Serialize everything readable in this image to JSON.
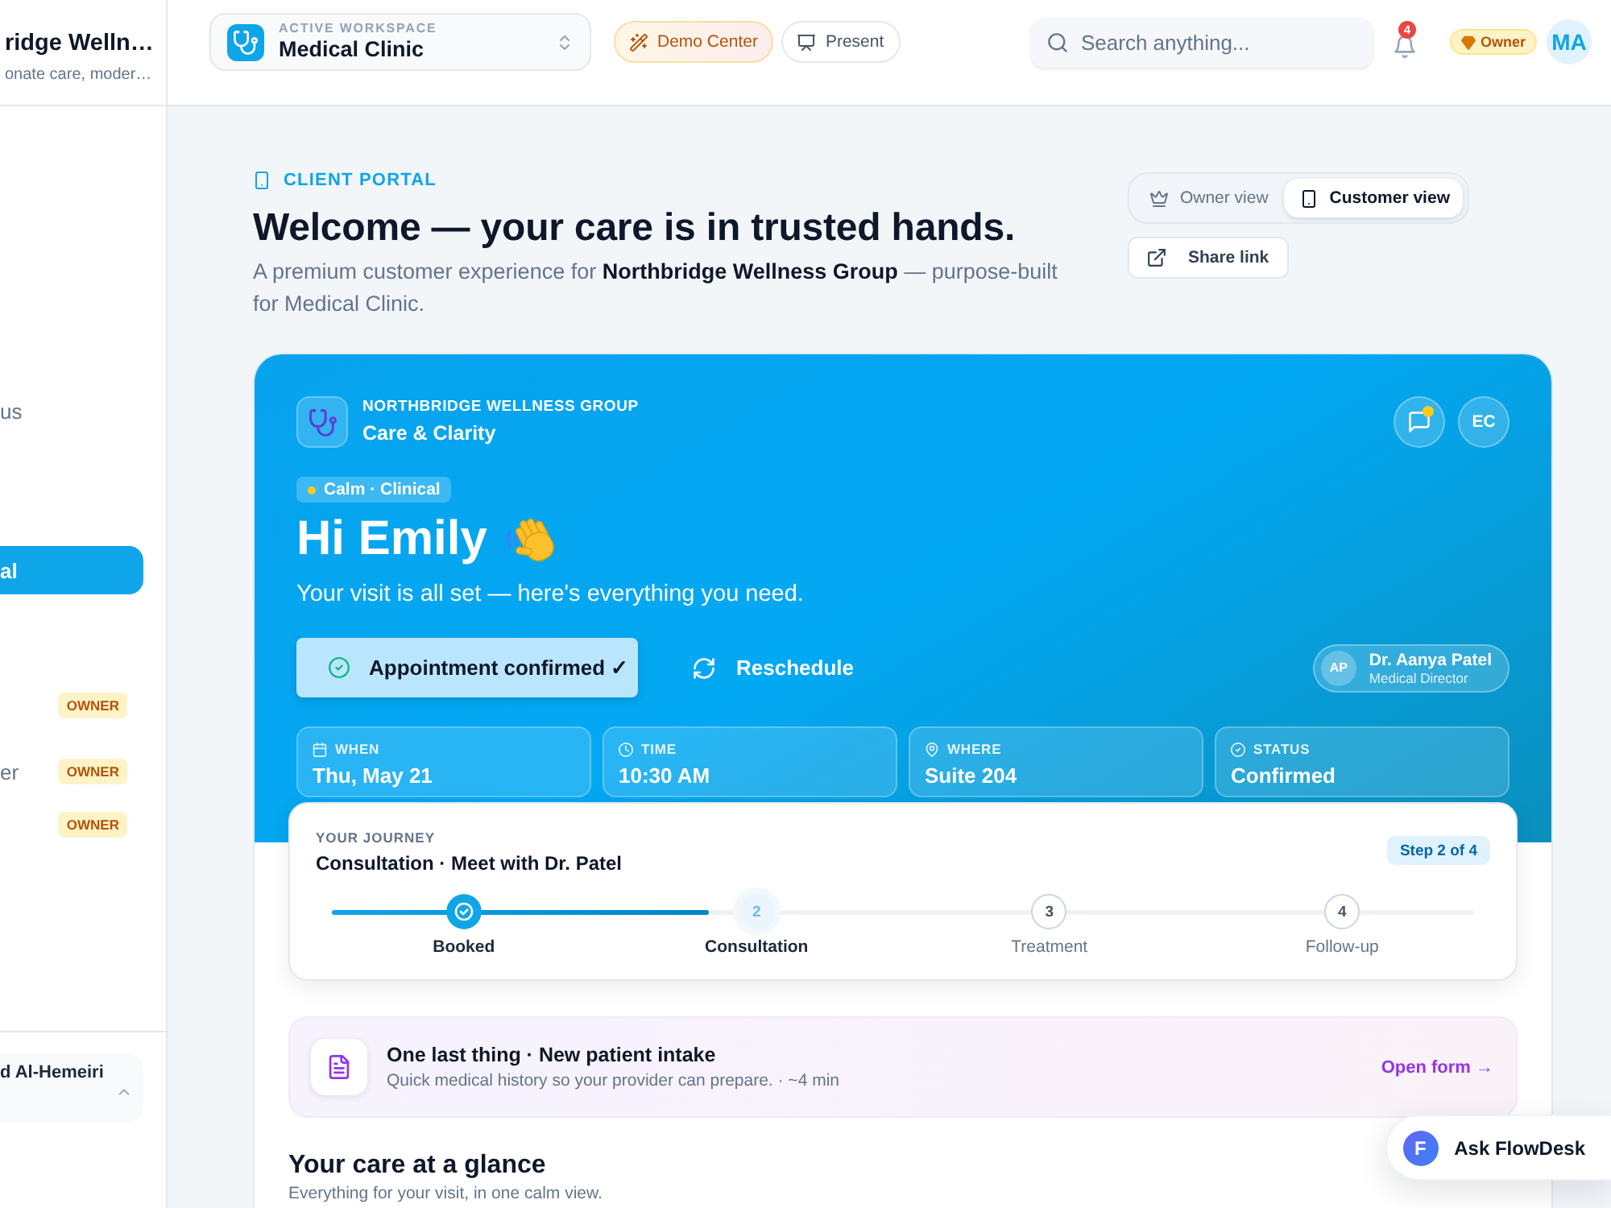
{
  "sidebar": {
    "brand": {
      "name": "ridge Welln…",
      "tagline": "onate care, moder…"
    },
    "items": [
      {
        "label": "us",
        "selected": false
      },
      {
        "label": "al",
        "selected": true
      },
      {
        "badge": "OWNER",
        "selected": false
      },
      {
        "label": "er",
        "badge": "OWNER",
        "selected": false
      },
      {
        "badge": "OWNER",
        "selected": false
      }
    ],
    "user": {
      "name": "d Al-Hemeiri"
    }
  },
  "header": {
    "workspace": {
      "caption": "ACTIVE WORKSPACE",
      "name": "Medical Clinic"
    },
    "buttons": [
      {
        "kind": "demo",
        "label": "Demo Center"
      },
      {
        "kind": "present",
        "label": "Present"
      }
    ],
    "search": {
      "placeholder": "Search anything..."
    },
    "notifications": {
      "count": "4"
    },
    "role_badge": "Owner",
    "avatar": "MA"
  },
  "page_header": {
    "eyebrow": "CLIENT PORTAL",
    "title": "Welcome — your care is in trusted hands.",
    "subtitle": "A premium customer experience for **Northbridge Wellness Group** — purpose-built for Medical Clinic.",
    "view_toggle": [
      {
        "kind": "owner",
        "label": "Owner view",
        "selected": false
      },
      {
        "kind": "customer",
        "label": "Customer view",
        "selected": true
      }
    ],
    "share_button": "Share link"
  },
  "hero": {
    "org": "NORTHBRIDGE WELLNESS GROUP",
    "program": "Care & Clarity",
    "messages": {
      "unread": true
    },
    "avatar": "EC",
    "tag": "Calm · Clinical",
    "greeting": "Hi Emily",
    "lead": "Your visit is all set — here's everything you need.",
    "primary_action": "Appointment confirmed ✓",
    "secondary_action": "Reschedule",
    "provider": {
      "initials": "AP",
      "name": "Dr. Aanya Patel",
      "role": "Medical Director"
    },
    "details": [
      {
        "kind": "date",
        "label": "WHEN",
        "value": "Thu, May 21"
      },
      {
        "kind": "time",
        "label": "TIME",
        "value": "10:30 AM"
      },
      {
        "kind": "location",
        "label": "WHERE",
        "value": "Suite 204"
      },
      {
        "kind": "status",
        "label": "STATUS",
        "value": "Confirmed"
      }
    ]
  },
  "journey": {
    "caption": "YOUR JOURNEY",
    "title": "Consultation · Meet with Dr. Patel",
    "step_badge": "Step 2 of 4",
    "level": 0.33,
    "steps": [
      {
        "done": true,
        "current": false,
        "label": "Booked"
      },
      {
        "done": false,
        "current": true,
        "number": "2",
        "label": "Consultation"
      },
      {
        "done": false,
        "current": false,
        "number": "3",
        "label": "Treatment"
      },
      {
        "done": false,
        "current": false,
        "number": "4",
        "label": "Follow-up"
      }
    ]
  },
  "intake": {
    "title": "One last thing · New patient intake",
    "text": "Quick medical history so your provider can prepare. · ~4 min",
    "action": "Open form →"
  },
  "glance": {
    "title": "Your care at a glance",
    "subtitle": "Everything for your visit, in one calm view."
  },
  "assistant": {
    "logo": "F",
    "label": "Ask FlowDesk"
  }
}
